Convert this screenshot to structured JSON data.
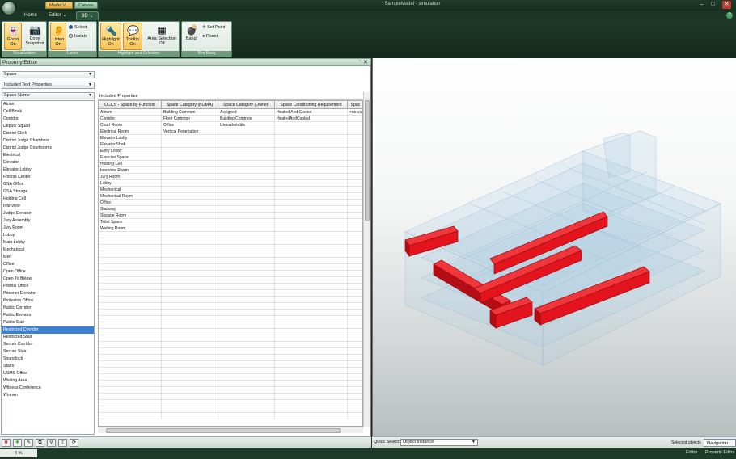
{
  "titlebar": {
    "title": "SampleModel - simulation",
    "ctx_tabs": [
      "Model V...",
      "Canvas"
    ]
  },
  "tabs": [
    "Home",
    "Editor",
    "3D"
  ],
  "active_tab": "3D",
  "ribbon": {
    "groups": [
      {
        "label": "Visualization",
        "buttons": [
          "Ghost On",
          "Copy Snapshot"
        ]
      },
      {
        "label": "Listen",
        "buttons": [
          "Listen On"
        ],
        "options": [
          "Select",
          "Isolate"
        ]
      },
      {
        "label": "Highlight and Selection",
        "buttons": [
          "Highlight On",
          "Tooltip On",
          "Area Selection Off"
        ]
      },
      {
        "label": "Bim Bang",
        "buttons": [
          "Bang!"
        ],
        "small": [
          "Set Point",
          "Reset"
        ]
      }
    ]
  },
  "property_editor": {
    "title": "Property Editor",
    "combos": [
      "Space",
      "Included Text Properties",
      "Space Name"
    ],
    "included_properties_label": "Included Properties",
    "space_names": [
      "Atrium",
      "Cell Block",
      "Corridor",
      "Deputy Squad",
      "District Clerk",
      "District Judge Chambers",
      "District Judge Courtrooms",
      "Electrical",
      "Elevator",
      "Elevator Lobby",
      "Fitness Center",
      "GSA Office",
      "GSA Storage",
      "Holding Cell",
      "Interview",
      "Judge Elevator",
      "Jury Assembly",
      "Jury Room",
      "Lobby",
      "Main Lobby",
      "Mechanical",
      "Men",
      "Office",
      "Open Office",
      "Open To Below",
      "Pretrial Office",
      "Prisoner Elevator",
      "Probation Office",
      "Public Corridor",
      "Public Elevator",
      "Public Stair",
      "Restricted Corridor",
      "Restricted Stair",
      "Secure Corridor",
      "Secure Stair",
      "Soundlock",
      "Stairs",
      "USMS Office",
      "Waiting Area",
      "Witness Conference",
      "Women"
    ],
    "selected_space": "Restricted Corridor",
    "columns": [
      "OCCS - Space by Function",
      "Space Category (BOMA)",
      "Space Category (Owner)",
      "Space Conditioning Requirement",
      "Spac"
    ],
    "rows": [
      [
        "Atrium",
        "Building Common",
        "Assigned",
        "Heated And Cooled",
        "<no va"
      ],
      [
        "Corridor",
        "Floor Common",
        "Building Common",
        "HeatedAndCooled",
        ""
      ],
      [
        "Court Room",
        "Office",
        "Unmarketable",
        "",
        ""
      ],
      [
        "Electrical Room",
        "Vertical Penetration",
        "",
        "",
        ""
      ],
      [
        "Elevator Lobby",
        "",
        "",
        "",
        ""
      ],
      [
        "Elevator Shaft",
        "",
        "",
        "",
        ""
      ],
      [
        "Entry Lobby",
        "",
        "",
        "",
        ""
      ],
      [
        "Exercise Space",
        "",
        "",
        "",
        ""
      ],
      [
        "Holding Cell",
        "",
        "",
        "",
        ""
      ],
      [
        "Interview Room",
        "",
        "",
        "",
        ""
      ],
      [
        "Jury Room",
        "",
        "",
        "",
        ""
      ],
      [
        "Lobby",
        "",
        "",
        "",
        ""
      ],
      [
        "Mechanical",
        "",
        "",
        "",
        ""
      ],
      [
        "Mechanical Room",
        "",
        "",
        "",
        ""
      ],
      [
        "Office",
        "",
        "",
        "",
        ""
      ],
      [
        "Stairway",
        "",
        "",
        "",
        ""
      ],
      [
        "Storage Room",
        "",
        "",
        "",
        ""
      ],
      [
        "Toilet Space",
        "",
        "",
        "",
        ""
      ],
      [
        "Waiting Room",
        "",
        "",
        "",
        ""
      ]
    ]
  },
  "viewport": {
    "highlight_color": "#e3141e",
    "ghost_color": "#a9cbe3"
  },
  "bottom": {
    "quick_select_label": "Quick Select:",
    "quick_select_value": "Object Instance",
    "selected_objects": "Selected objects",
    "navigation_tab": "Navigation"
  },
  "status": {
    "progress": "0 %",
    "editor": "Editor",
    "property_editor": "Property Editor"
  }
}
